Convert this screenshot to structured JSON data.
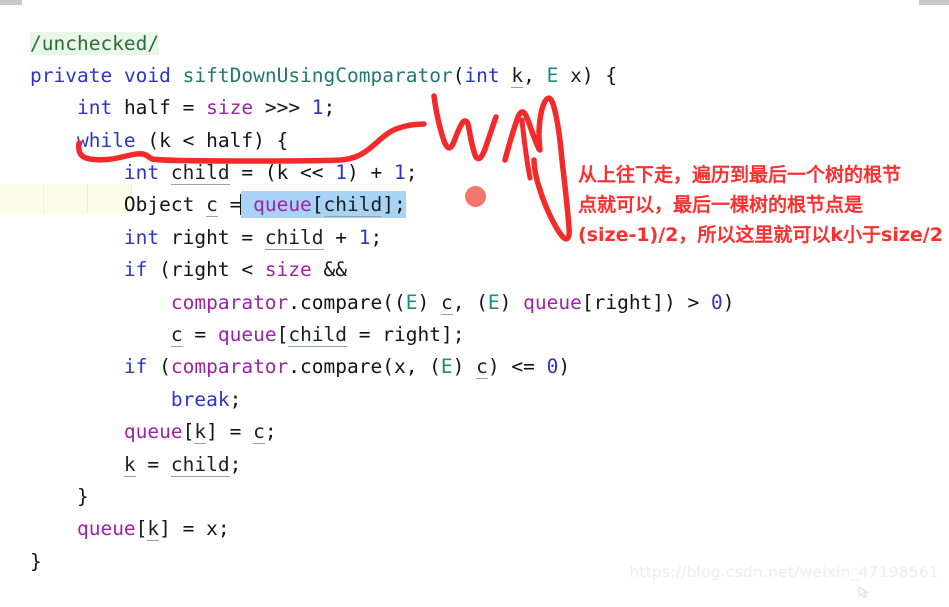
{
  "app": {
    "kind": "code-editor-screenshot",
    "language": "Java"
  },
  "code": {
    "lines": [
      {
        "indent": 0,
        "text": "/unchecked/"
      },
      {
        "indent": 0,
        "text": "private void siftDownUsingComparator(int k, E x) {"
      },
      {
        "indent": 1,
        "text": "int half = size >>> 1;"
      },
      {
        "indent": 1,
        "text": "while (k < half) {"
      },
      {
        "indent": 2,
        "text": "int child = (k << 1) + 1;"
      },
      {
        "indent": 2,
        "text": "Object c = queue[child];"
      },
      {
        "indent": 2,
        "text": "int right = child + 1;"
      },
      {
        "indent": 2,
        "text": "if (right < size &&"
      },
      {
        "indent": 3,
        "text": "comparator.compare((E) c, (E) queue[right]) > 0)"
      },
      {
        "indent": 3,
        "text": "c = queue[child = right];"
      },
      {
        "indent": 2,
        "text": "if (comparator.compare(x, (E) c) <= 0)"
      },
      {
        "indent": 3,
        "text": "break;"
      },
      {
        "indent": 2,
        "text": "queue[k] = c;"
      },
      {
        "indent": 2,
        "text": "k = child;"
      },
      {
        "indent": 1,
        "text": "}"
      },
      {
        "indent": 1,
        "text": "queue[k] = x;"
      },
      {
        "indent": 0,
        "text": "}"
      }
    ],
    "tokens": {
      "comment": "/unchecked/",
      "keywords": [
        "private",
        "void",
        "int",
        "while",
        "if",
        "break"
      ],
      "method_name": "siftDownUsingComparator",
      "generic_type": "E",
      "fields": [
        "size",
        "queue",
        "comparator"
      ],
      "locals": [
        "k",
        "x",
        "half",
        "child",
        "c",
        "right"
      ],
      "literals": [
        "1",
        "0"
      ]
    },
    "selection": {
      "text": "queue[child];",
      "line_number_in_block": 6,
      "caret_visible": true
    }
  },
  "annotation": {
    "note_text": "从上往下走，遍历到最后一个树的根节\n点就可以，最后一棵树的根节点是\n(size-1)/2，所以这里就可以k小于size/2",
    "ink_color": "#ff2f2f",
    "dot_color": "#f3776b",
    "underline_target": "while (k < half) {",
    "scribbles": [
      "w-stroke",
      "m-stroke"
    ]
  },
  "colors": {
    "background": "#ffffff",
    "keyword": "#2c35c4",
    "method": "#22796f",
    "type": "#1f8a80",
    "field": "#9d24a6",
    "number": "#2c35c4",
    "comment_text": "#2d6d36",
    "comment_bg": "#eaf6ea",
    "selection_bg": "#a7d3f5",
    "current_line_bg": "#fdfce8",
    "annotation_red": "#ff2f2f",
    "watermark": "#ededed"
  },
  "watermark": {
    "text": "https://blog.csdn.net/weixin_47198561"
  }
}
